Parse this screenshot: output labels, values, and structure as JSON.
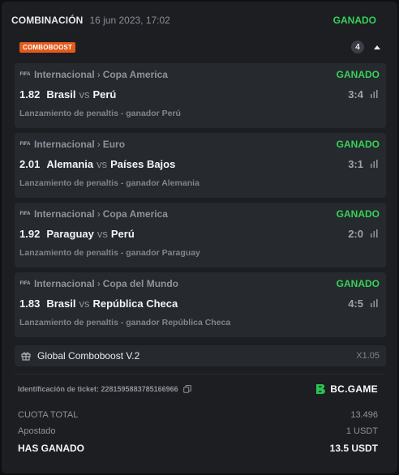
{
  "header": {
    "title": "COMBINACIÓN",
    "date": "16 jun 2023, 17:02",
    "status": "GANADO"
  },
  "comboboost": {
    "badge": "COMBOBOOST",
    "count": "4",
    "expanded": true
  },
  "matches": [
    {
      "provider": "FIFA",
      "category": "Internacional",
      "league": "Copa America",
      "status": "GANADO",
      "odds": "1.82",
      "home": "Brasil",
      "vs": "vs",
      "away": "Perú",
      "score": "3:4",
      "description": "Lanzamiento de penaltis - ganador Perú"
    },
    {
      "provider": "FIFA",
      "category": "Internacional",
      "league": "Euro",
      "status": "GANADO",
      "odds": "2.01",
      "home": "Alemania",
      "vs": "vs",
      "away": "Países Bajos",
      "score": "3:1",
      "description": "Lanzamiento de penaltis - ganador Alemania"
    },
    {
      "provider": "FIFA",
      "category": "Internacional",
      "league": "Copa America",
      "status": "GANADO",
      "odds": "1.92",
      "home": "Paraguay",
      "vs": "vs",
      "away": "Perú",
      "score": "2:0",
      "description": "Lanzamiento de penaltis - ganador Paraguay"
    },
    {
      "provider": "FIFA",
      "category": "Internacional",
      "league": "Copa del Mundo",
      "status": "GANADO",
      "odds": "1.83",
      "home": "Brasil",
      "vs": "vs",
      "away": "República Checa",
      "score": "4:5",
      "description": "Lanzamiento de penaltis - ganador República Checa"
    }
  ],
  "global_boost": {
    "label": "Global Comboboost V.2",
    "value": "X1.05",
    "icon": "gift-icon"
  },
  "ticket": {
    "label": "Identificación de ticket: 2281595883785166966",
    "brand": "BC.GAME"
  },
  "summary": {
    "total_odds_label": "CUOTA TOTAL",
    "total_odds_value": "13.496",
    "staked_label": "Apostado",
    "staked_value": "1 USDT",
    "won_label": "HAS GANADO",
    "won_value": "13.5 USDT"
  },
  "colors": {
    "background": "#1c1e22",
    "panel": "#26292e",
    "win_green": "#37d159",
    "boost_orange": "#e35a1b",
    "brand_green": "#29c256"
  }
}
